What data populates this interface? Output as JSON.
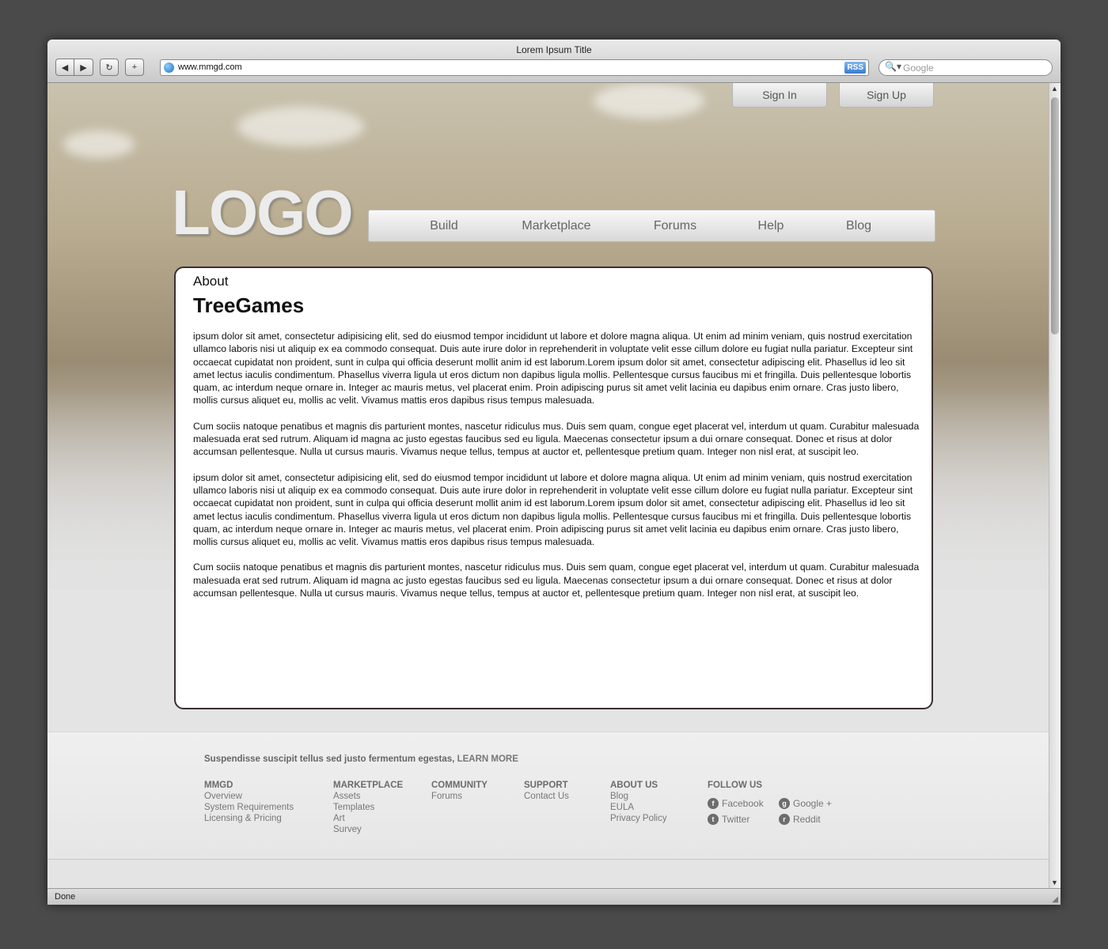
{
  "window": {
    "title": "Lorem Ipsum Title",
    "status": "Done"
  },
  "toolbar": {
    "back_icon": "◀",
    "forward_icon": "▶",
    "reload_icon": "↻",
    "new_tab_icon": "+",
    "url": "www.mmgd.com",
    "rss_label": "RSS",
    "search_placeholder": "Google",
    "search_icon": "🔍▾"
  },
  "header": {
    "sign_in": "Sign In",
    "sign_up": "Sign Up",
    "logo": "LOGO"
  },
  "nav": {
    "items": [
      "Build",
      "Marketplace",
      "Forums",
      "Help",
      "Blog"
    ]
  },
  "content": {
    "section": "About",
    "title": "TreeGames",
    "paragraphs": [
      " ipsum dolor sit amet, consectetur adipisicing elit, sed do eiusmod tempor incididunt ut labore et dolore magna aliqua. Ut enim ad minim veniam, quis nostrud exercitation ullamco laboris nisi ut aliquip ex ea commodo consequat. Duis aute irure dolor in reprehenderit in voluptate velit esse cillum dolore eu fugiat nulla pariatur. Excepteur sint occaecat cupidatat non proident, sunt in culpa qui officia deserunt mollit anim id est laborum.Lorem ipsum dolor sit amet, consectetur adipiscing elit. Phasellus id leo sit amet lectus iaculis condimentum. Phasellus viverra ligula ut eros dictum non dapibus ligula mollis. Pellentesque cursus faucibus mi et fringilla. Duis pellentesque lobortis quam, ac interdum neque ornare in. Integer ac mauris metus, vel placerat enim. Proin adipiscing purus sit amet velit lacinia eu dapibus enim ornare. Cras justo libero, mollis cursus aliquet eu, mollis ac velit. Vivamus mattis eros dapibus risus tempus malesuada.",
      "Cum sociis natoque penatibus et magnis dis parturient montes, nascetur ridiculus mus. Duis sem quam, congue eget placerat vel, interdum ut quam. Curabitur malesuada malesuada erat sed rutrum. Aliquam id magna ac justo egestas faucibus sed eu ligula. Maecenas consectetur ipsum a dui ornare consequat. Donec et risus at dolor accumsan pellentesque. Nulla ut cursus mauris. Vivamus neque tellus, tempus at auctor et, pellentesque pretium quam. Integer non nisl erat, at suscipit leo.",
      " ipsum dolor sit amet, consectetur adipisicing elit, sed do eiusmod tempor incididunt ut labore et dolore magna aliqua. Ut enim ad minim veniam, quis nostrud exercitation ullamco laboris nisi ut aliquip ex ea commodo consequat. Duis aute irure dolor in reprehenderit in voluptate velit esse cillum dolore eu fugiat nulla pariatur. Excepteur sint occaecat cupidatat non proident, sunt in culpa qui officia deserunt mollit anim id est laborum.Lorem ipsum dolor sit amet, consectetur adipiscing elit. Phasellus id leo sit amet lectus iaculis condimentum. Phasellus viverra ligula ut eros dictum non dapibus ligula mollis. Pellentesque cursus faucibus mi et fringilla. Duis pellentesque lobortis quam, ac interdum neque ornare in. Integer ac mauris metus, vel placerat enim. Proin adipiscing purus sit amet velit lacinia eu dapibus enim ornare. Cras justo libero, mollis cursus aliquet eu, mollis ac velit. Vivamus mattis eros dapibus risus tempus malesuada.",
      "Cum sociis natoque penatibus et magnis dis parturient montes, nascetur ridiculus mus. Duis sem quam, congue eget placerat vel, interdum ut quam. Curabitur malesuada malesuada erat sed rutrum. Aliquam id magna ac justo egestas faucibus sed eu ligula. Maecenas consectetur ipsum a dui ornare consequat. Donec et risus at dolor accumsan pellentesque. Nulla ut cursus mauris. Vivamus neque tellus, tempus at auctor et, pellentesque pretium quam. Integer non nisl erat, at suscipit leo."
    ]
  },
  "footer": {
    "tagline": "Suspendisse suscipit tellus sed justo fermentum egestas,",
    "learn_more": "LEARN MORE",
    "columns": [
      {
        "heading": "MMGD",
        "links": [
          "Overview",
          "System Requirements",
          "Licensing & Pricing"
        ]
      },
      {
        "heading": "MARKETPLACE",
        "links": [
          "Assets",
          "Templates",
          "Art",
          "Survey"
        ]
      },
      {
        "heading": "COMMUNITY",
        "links": [
          "Forums"
        ]
      },
      {
        "heading": "SUPPORT",
        "links": [
          "Contact Us"
        ]
      },
      {
        "heading": "ABOUT US",
        "links": [
          "Blog",
          "EULA",
          "Privacy Policy"
        ]
      }
    ],
    "follow": {
      "heading": "FOLLOW US",
      "facebook": "Facebook",
      "google": "Google +",
      "twitter": "Twitter",
      "reddit": "Reddit"
    }
  }
}
